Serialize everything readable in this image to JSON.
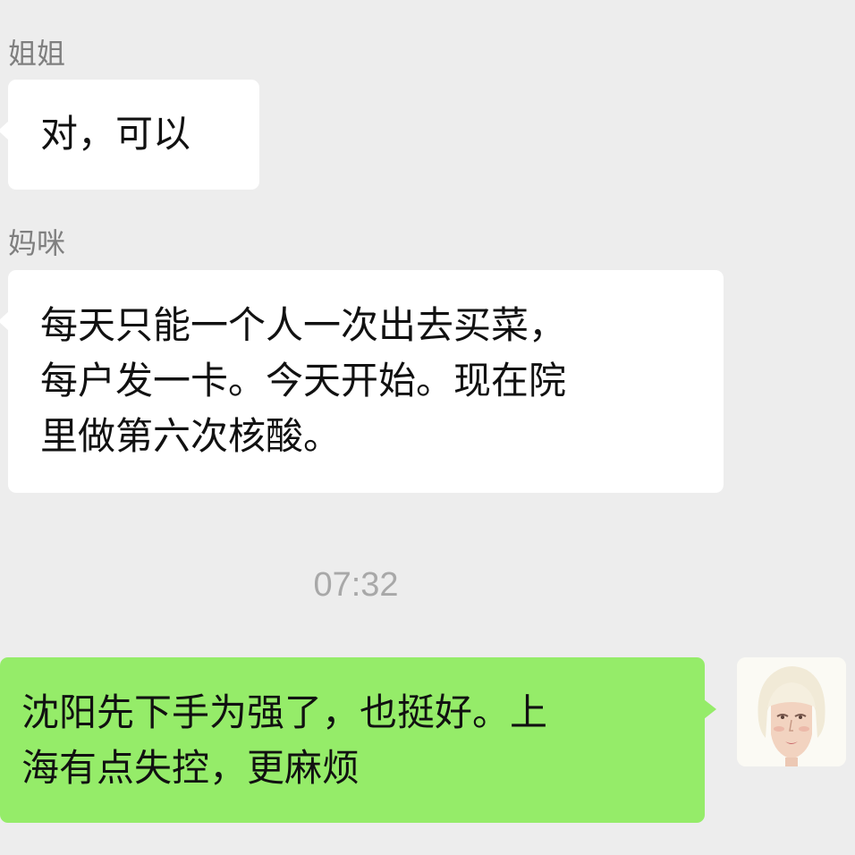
{
  "messages": [
    {
      "sender": "姐姐",
      "text": "对，可以"
    },
    {
      "sender": "妈咪",
      "text": "每天只能一个人一次出去买菜，\n每户发一卡。今天开始。现在院\n里做第六次核酸。"
    }
  ],
  "timestamp": "07:32",
  "my_message": {
    "text": "沈阳先下手为强了，也挺好。上\n海有点失控，更麻烦"
  },
  "colors": {
    "background": "#ededed",
    "incoming_bubble": "#ffffff",
    "outgoing_bubble": "#95ec69",
    "sender_name": "#7f7f7f",
    "timestamp": "#a8a8a8"
  }
}
